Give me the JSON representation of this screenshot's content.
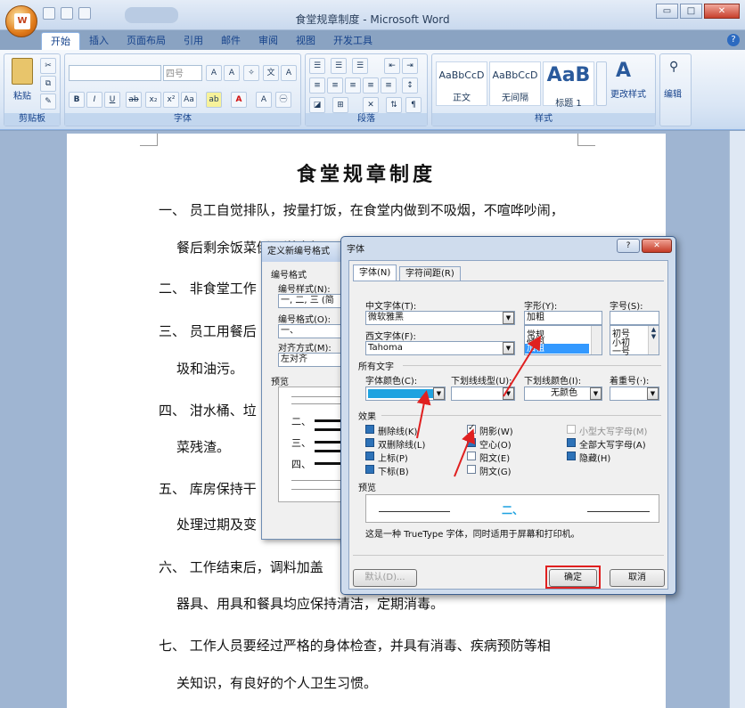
{
  "window": {
    "title": "食堂规章制度 - Microsoft Word",
    "win_min": "▭",
    "win_max": "□",
    "win_close": "✕"
  },
  "ribbon": {
    "tabs": [
      "开始",
      "插入",
      "页面布局",
      "引用",
      "邮件",
      "审阅",
      "视图",
      "开发工具"
    ],
    "groups": {
      "clipboard": "剪贴板",
      "font": "字体",
      "paragraph": "段落",
      "styles": "样式"
    },
    "paste_label": "粘贴",
    "font_size_field": "四号",
    "styles": [
      {
        "sample": "AaBbCcD",
        "name": "正文"
      },
      {
        "sample": "AaBbCcD",
        "name": "无间隔"
      },
      {
        "sample": "AaB",
        "name": "标题 1"
      }
    ],
    "change_styles": "更改样式",
    "edit": "编辑"
  },
  "document": {
    "title": "食堂规章制度",
    "lines": [
      {
        "text": "一、  员工自觉排队，按量打饭，在食堂内做到不吸烟，不喧哗吵闹，"
      },
      {
        "text": "餐后剩余饭菜倒入泔水桶"
      },
      {
        "text": "二、  非食堂工作"
      },
      {
        "text": "三、  员工用餐后"
      },
      {
        "text": "圾和油污。"
      },
      {
        "text": "四、  泔水桶、垃"
      },
      {
        "text": "菜残渣。"
      },
      {
        "text": "五、  库房保持干"
      },
      {
        "text": "处理过期及变"
      },
      {
        "text": "六、  工作结束后，调料加盖"
      },
      {
        "text": "器具、用具和餐具均应保持清洁，定期消毒。"
      },
      {
        "text": "七、  工作人员要经过严格的身体检查，并具有消毒、疾病预防等相"
      },
      {
        "text": "关知识，有良好的个人卫生习惯。"
      }
    ]
  },
  "numbering_dialog": {
    "title": "定义新编号格式",
    "section": "编号格式",
    "style_label": "编号样式(N):",
    "style_value": "一, 二, 三 (简",
    "format_label": "编号格式(O):",
    "format_value": "一、",
    "align_label": "对齐方式(M):",
    "align_value": "左对齐",
    "preview_label": "预览",
    "preview_items": [
      "二、",
      "三、",
      "四、"
    ]
  },
  "font_dialog": {
    "title": "字体",
    "help": "?",
    "close": "✕",
    "tabs": [
      "字体(N)",
      "字符间距(R)"
    ],
    "cn_font_label": "中文字体(T):",
    "cn_font_value": "微软雅黑",
    "west_font_label": "西文字体(F):",
    "west_font_value": "Tahoma",
    "style_label": "字形(Y):",
    "style_value": "加粗",
    "style_options": [
      "常规",
      "倾斜",
      "加粗"
    ],
    "size_label": "字号(S):",
    "size_options": [
      "初号",
      "小初",
      "一号"
    ],
    "all_text_label": "所有文字",
    "color_label": "字体颜色(C):",
    "color_value": "#1fa3e0",
    "underline_label": "下划线线型(U):",
    "underline_color_label": "下划线颜色(I):",
    "underline_color_value": "无颜色",
    "emphasis_label": "着重号(·):",
    "effects_label": "效果",
    "effects": [
      {
        "label": "删除线(K)",
        "state": "mixed"
      },
      {
        "label": "双删除线(L)",
        "state": "mixed"
      },
      {
        "label": "上标(P)",
        "state": "mixed"
      },
      {
        "label": "下标(B)",
        "state": "mixed"
      },
      {
        "label": "阴影(W)",
        "state": "checked"
      },
      {
        "label": "空心(O)",
        "state": "mixed"
      },
      {
        "label": "阳文(E)",
        "state": "off"
      },
      {
        "label": "阴文(G)",
        "state": "off"
      },
      {
        "label": "小型大写字母(M)",
        "state": "disabled"
      },
      {
        "label": "全部大写字母(A)",
        "state": "mixed"
      },
      {
        "label": "隐藏(H)",
        "state": "mixed"
      }
    ],
    "preview_label": "预览",
    "preview_text": "二、",
    "note": "这是一种 TrueType 字体，同时适用于屏幕和打印机。",
    "default_btn": "默认(D)...",
    "ok_btn": "确定",
    "cancel_btn": "取消",
    "highlight_color": "#e02020"
  }
}
